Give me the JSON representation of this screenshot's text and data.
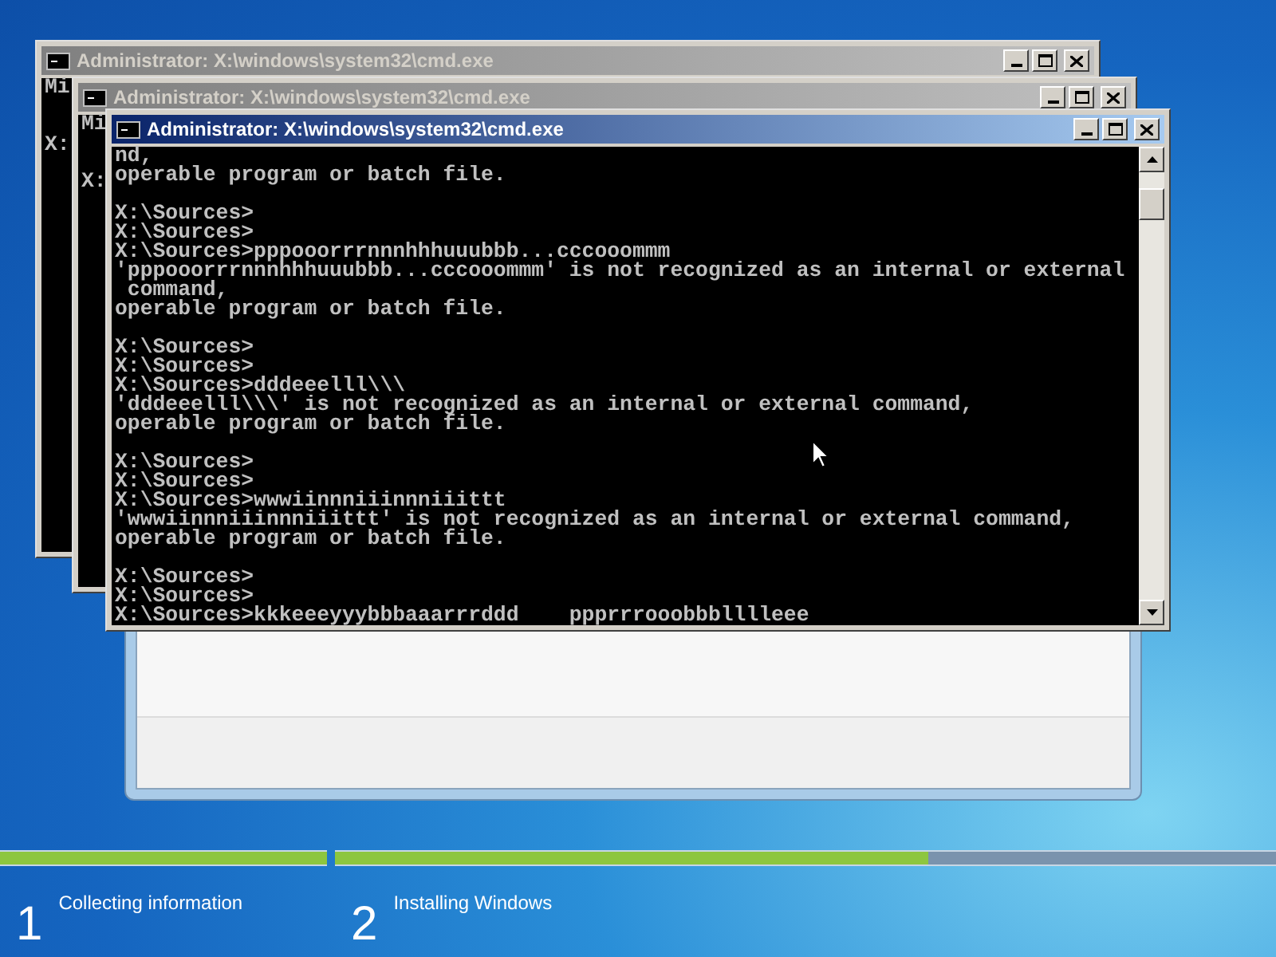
{
  "console_windows": [
    {
      "title": "Administrator: X:\\windows\\system32\\cmd.exe",
      "active": false,
      "blocks": [
        [
          "Mi"
        ],
        [
          "X:"
        ]
      ]
    },
    {
      "title": "Administrator: X:\\windows\\system32\\cmd.exe",
      "active": false,
      "blocks": [
        [
          "Mi"
        ],
        [
          "X:"
        ]
      ]
    },
    {
      "title": "Administrator: X:\\windows\\system32\\cmd.exe",
      "active": true,
      "blocks": [
        [
          "nd,",
          "operable program or batch file."
        ],
        [
          "X:\\Sources>",
          "X:\\Sources>",
          "X:\\Sources>pppooorrrnnnhhhuuubbb...cccooommm",
          "'pppooorrrnnnhhhuuubbb...cccooommm' is not recognized as an internal or external",
          " command,",
          "operable program or batch file."
        ],
        [
          "X:\\Sources>",
          "X:\\Sources>",
          "X:\\Sources>dddeeelll\\\\\\",
          "'dddeeelll\\\\\\' is not recognized as an internal or external command,",
          "operable program or batch file."
        ],
        [
          "X:\\Sources>",
          "X:\\Sources>",
          "X:\\Sources>wwwiinnniiinnniiittt",
          "'wwwiinnniiinnniiittt' is not recognized as an internal or external command,",
          "operable program or batch file."
        ],
        [
          "X:\\Sources>",
          "X:\\Sources>",
          "X:\\Sources>kkkeeeyyybbbaaarrrddd    ppprrrooobbblllleee"
        ]
      ]
    }
  ],
  "setup_steps": [
    {
      "number": "1",
      "label": "Collecting information",
      "level": 1
    },
    {
      "number": "2",
      "label": "Installing Windows",
      "level": 0.63
    }
  ]
}
